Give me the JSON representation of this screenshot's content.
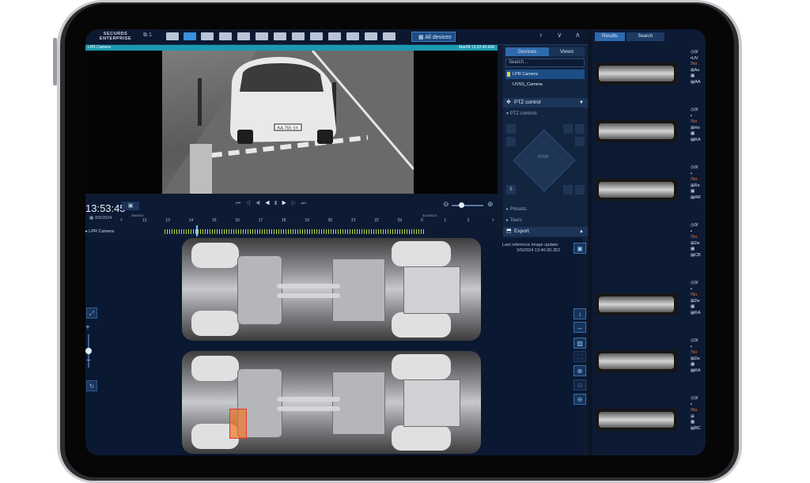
{
  "app": {
    "logo_line1": "SECURDS",
    "logo_line2": "ENTERPRISE",
    "layout_count": "1"
  },
  "toolbar": {
    "all_devices_label": "All devices"
  },
  "camera": {
    "name": "LPR Camera",
    "timestamp": "Mar09 13:53:45.668",
    "plate": "KA 755 SY"
  },
  "devices_panel": {
    "tabs": [
      "Devices",
      "Views"
    ],
    "search_placeholder": "Search...",
    "devices": [
      "LPR Camera",
      "UVSS_Camera"
    ],
    "ptz_control_label": "PTZ control",
    "ptz_controls_label": "PTZ controls",
    "stop_label": "STOP",
    "zoom_value": "5",
    "presets_label": "Presets:",
    "tours_label": "Tours:",
    "export_label": "Export"
  },
  "timeline": {
    "time": "13:53:45",
    "date": "3/9/2024",
    "date_left": "3/9/2024",
    "date_right": "3/10/2024",
    "hours": [
      "12",
      "13",
      "14",
      "15",
      "16",
      "17",
      "18",
      "19",
      "20",
      "21",
      "22",
      "23",
      "0",
      "1",
      "2"
    ],
    "camera_label": "LPR Camera"
  },
  "uvss": {
    "reference_note_line1": "Last reference image update:",
    "reference_note_line2": "3/9/2024 13:40:30.352"
  },
  "results_panel": {
    "tabs": [
      "Results",
      "Search"
    ],
    "entries": [
      {
        "time": "3/",
        "line2": "UV",
        "status": "No",
        "line4": "Au",
        "line5": "",
        "plate": "AA"
      },
      {
        "time": "3/",
        "line2": "",
        "status": "No",
        "line4": "Ho",
        "line5": "",
        "plate": "KA"
      },
      {
        "time": "3/",
        "line2": "",
        "status": "No",
        "line4": "Re",
        "line5": "",
        "plate": "AR"
      },
      {
        "time": "3/",
        "line2": "",
        "status": "No",
        "line4": "De",
        "line5": "",
        "plate": "CB"
      },
      {
        "time": "3/",
        "line2": "",
        "status": "No",
        "line4": "De",
        "line5": "",
        "plate": "KA"
      },
      {
        "time": "3/",
        "line2": "",
        "status": "No",
        "line4": "De",
        "line5": "",
        "plate": "KA"
      },
      {
        "time": "3/",
        "line2": "",
        "status": "No",
        "line4": "",
        "line5": "",
        "plate": "BC"
      }
    ]
  },
  "colors": {
    "accent": "#3d8fe0",
    "track": "#b9d94a",
    "alert": "#e8743a",
    "panel": "#13243f"
  }
}
